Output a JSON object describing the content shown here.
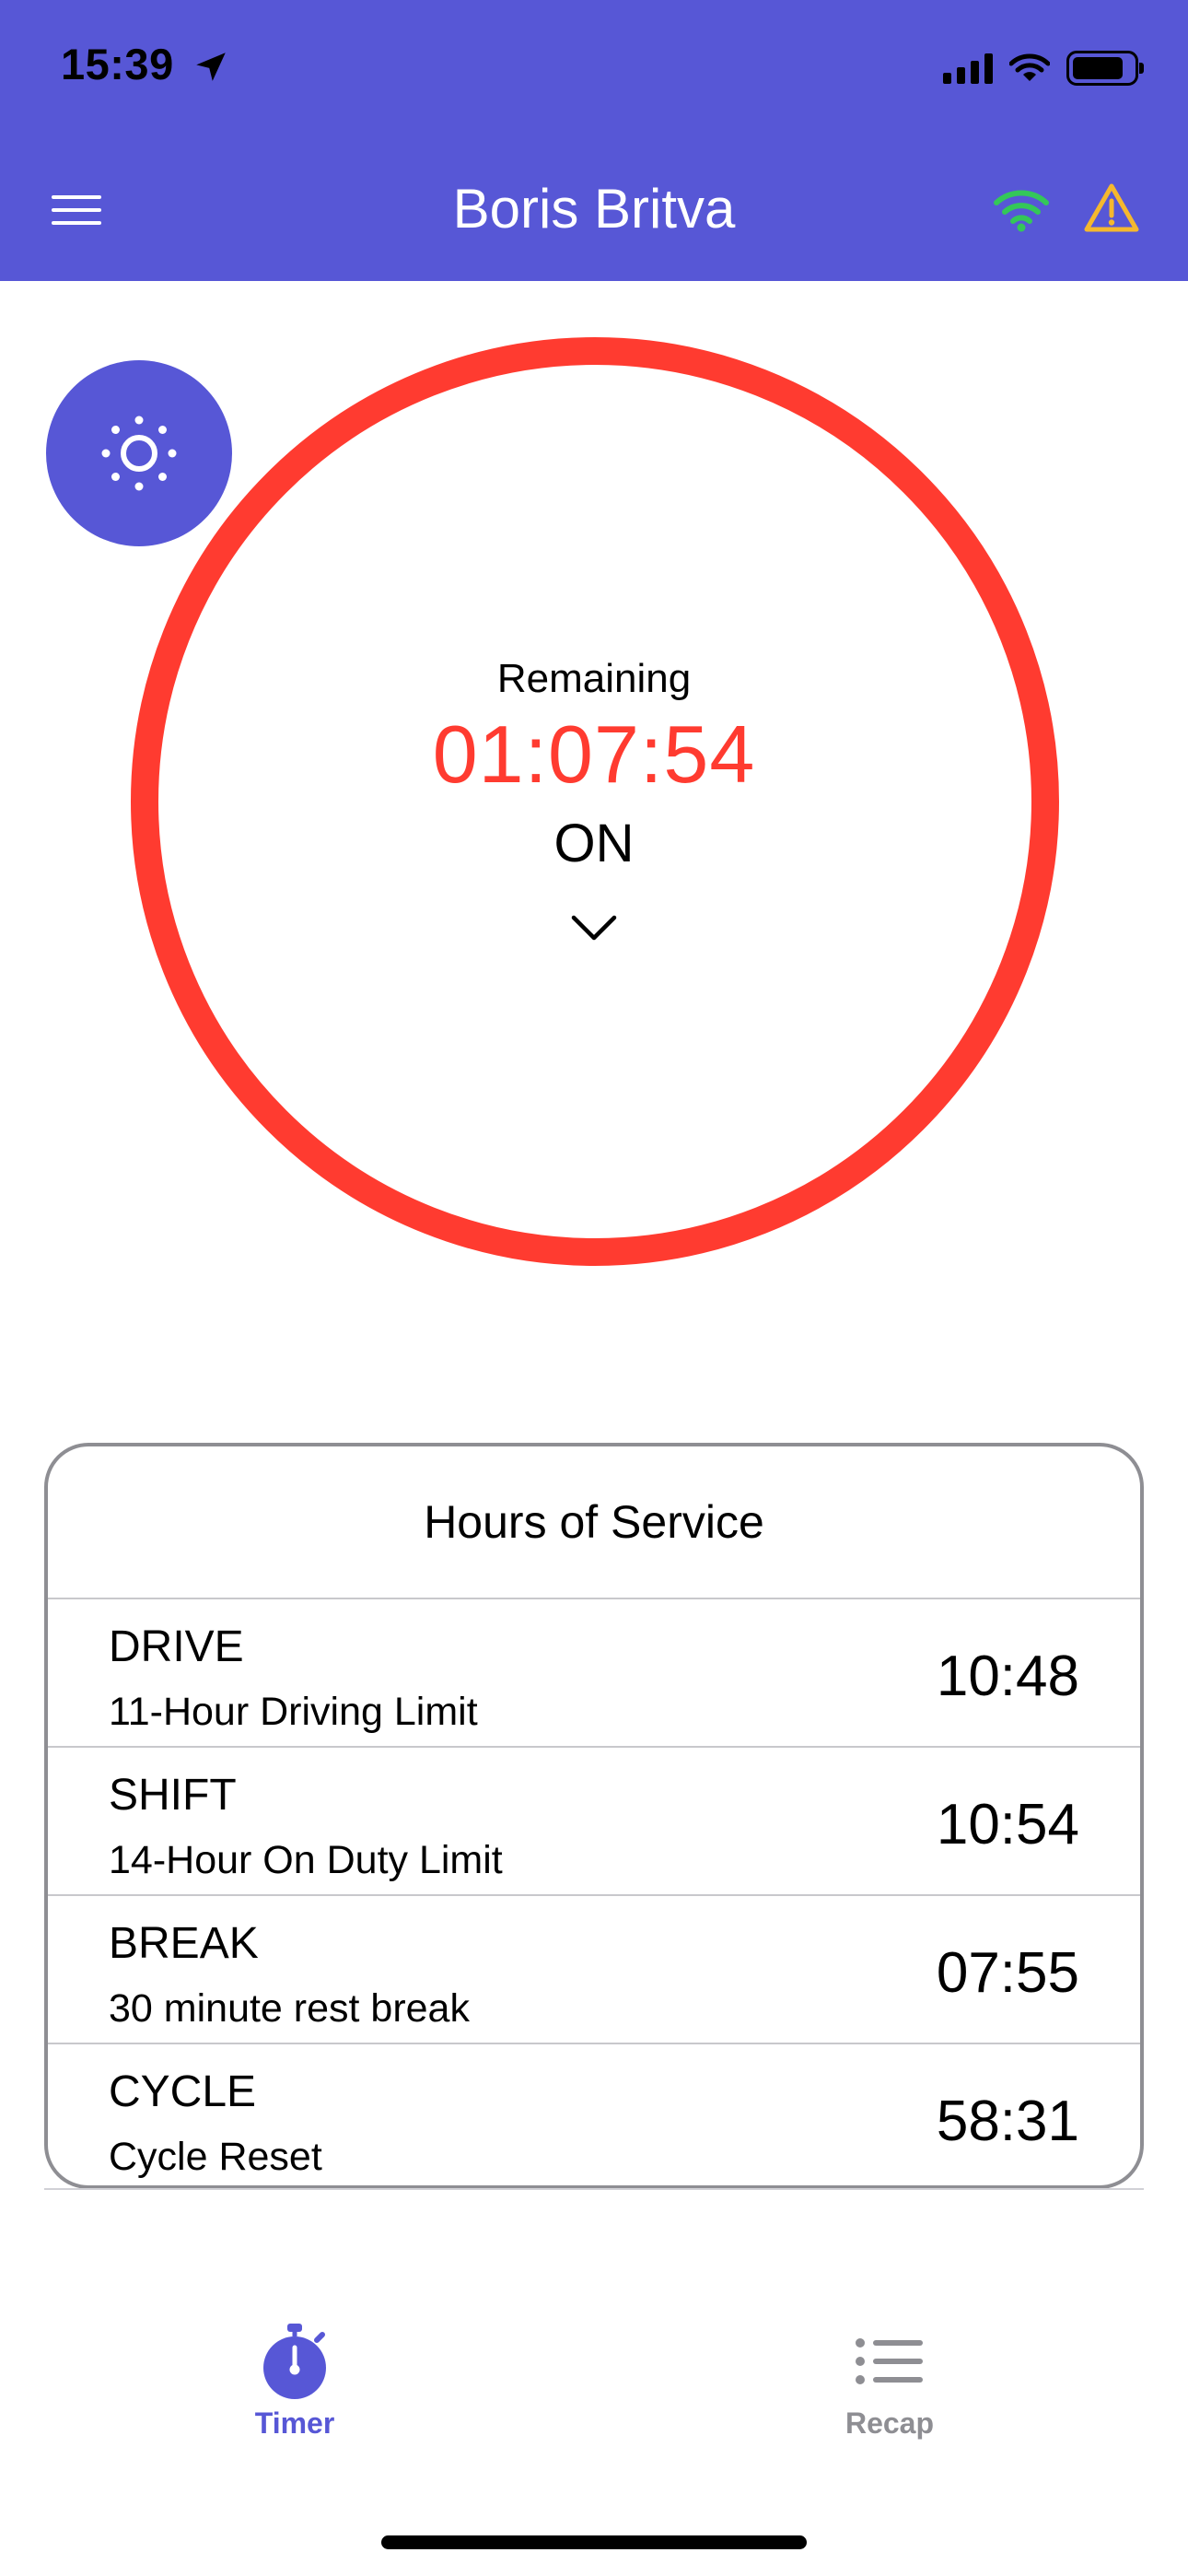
{
  "status_bar": {
    "time": "15:39",
    "location_icon": "location-arrow-icon",
    "cellular_icon": "cellular-signal-icon",
    "wifi_icon": "wifi-icon",
    "battery_icon": "battery-icon"
  },
  "nav": {
    "title": "Boris Britva",
    "menu_icon": "hamburger-menu-icon",
    "connection_icon": "wifi-icon",
    "warning_icon": "warning-triangle-icon"
  },
  "timer": {
    "label": "Remaining",
    "value": "01:07:54",
    "status": "ON",
    "settings_icon": "brightness-icon",
    "expand_icon": "chevron-down-icon"
  },
  "hours_of_service": {
    "title": "Hours of Service",
    "rows": [
      {
        "name": "DRIVE",
        "description": "11-Hour Driving Limit",
        "value": "10:48"
      },
      {
        "name": "SHIFT",
        "description": "14-Hour On Duty Limit",
        "value": "10:54"
      },
      {
        "name": "BREAK",
        "description": "30 minute rest break",
        "value": "07:55"
      },
      {
        "name": "CYCLE",
        "description": "Cycle Reset",
        "value": "58:31"
      }
    ]
  },
  "tabs": [
    {
      "label": "Timer",
      "icon": "stopwatch-icon",
      "active": true
    },
    {
      "label": "Recap",
      "icon": "list-icon",
      "active": false
    }
  ],
  "colors": {
    "brand": "#5757d6",
    "alert": "#ff3b30",
    "connected": "#34c759",
    "warning": "#f5b82e",
    "inactive": "#8e8e93"
  }
}
